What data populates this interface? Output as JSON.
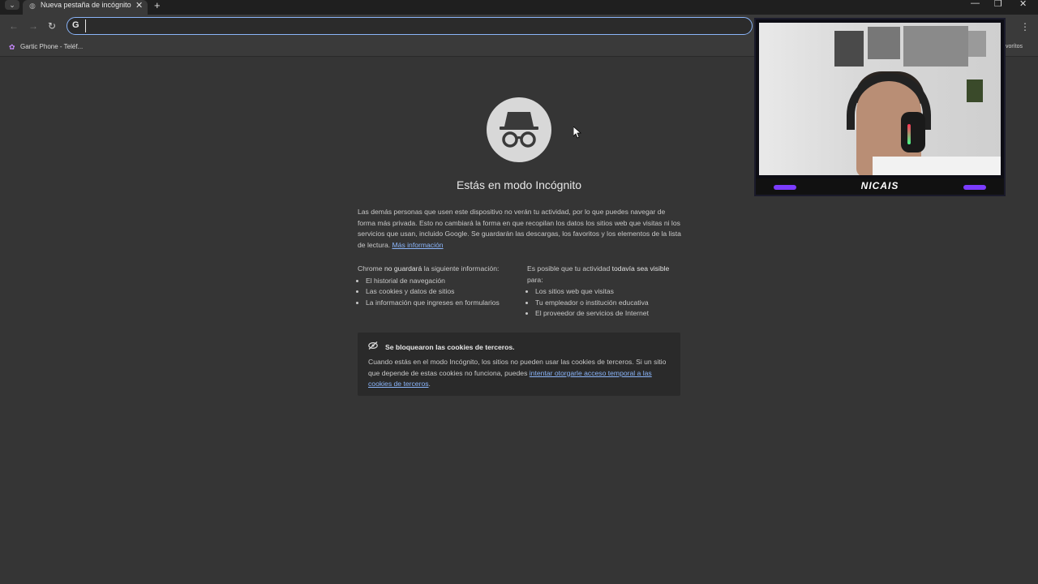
{
  "browser": {
    "tab_title": "Nueva pestaña de incógnito",
    "tab_close": "✕",
    "new_tab": "+",
    "window_controls": {
      "minimize": "—",
      "maximize": "❐",
      "close": "✕"
    }
  },
  "toolbar": {
    "back": "←",
    "forward": "→",
    "reload": "↻",
    "omnibox_icon": "G",
    "omnibox_value": "",
    "menu": "⋮"
  },
  "bookmarks": {
    "items": [
      {
        "label": "Gartic Phone - Teléf..."
      }
    ],
    "right_label": "vorítos"
  },
  "page": {
    "heading": "Estás en modo Incógnito",
    "paragraph": "Las demás personas que usen este dispositivo no verán tu actividad, por lo que puedes navegar de forma más privada. Esto no cambiará la forma en que recopilan los datos los sitios web que visitas ni los servicios que usan, incluido Google. Se guardarán las descargas, los favoritos y los elementos de la lista de lectura. ",
    "learn_more": "Más información",
    "left_col": {
      "intro_pre": "Chrome ",
      "intro_bold": "no guardará",
      "intro_post": " la siguiente información:",
      "items": [
        "El historial de navegación",
        "Las cookies y datos de sitios",
        "La información que ingreses en formularios"
      ]
    },
    "right_col": {
      "intro_pre": "Es posible que tu actividad ",
      "intro_bold": "todavía sea visible",
      "intro_post": " para:",
      "items": [
        "Los sitios web que visitas",
        "Tu empleador o institución educativa",
        "El proveedor de servicios de Internet"
      ]
    },
    "cookie_card": {
      "title": "Se bloquearon las cookies de terceros.",
      "text": "Cuando estás en el modo Incógnito, los sitios no pueden usar las cookies de terceros. Si un sitio que depende de estas cookies no funciona, puedes ",
      "link": "intentar otorgarle acceso temporal a las cookies de terceros",
      "end": "."
    }
  },
  "webcam": {
    "name": "NICAIS"
  },
  "colors": {
    "accent": "#8ab4f8",
    "background": "#353535",
    "webcam_accent": "#7b3cff"
  }
}
